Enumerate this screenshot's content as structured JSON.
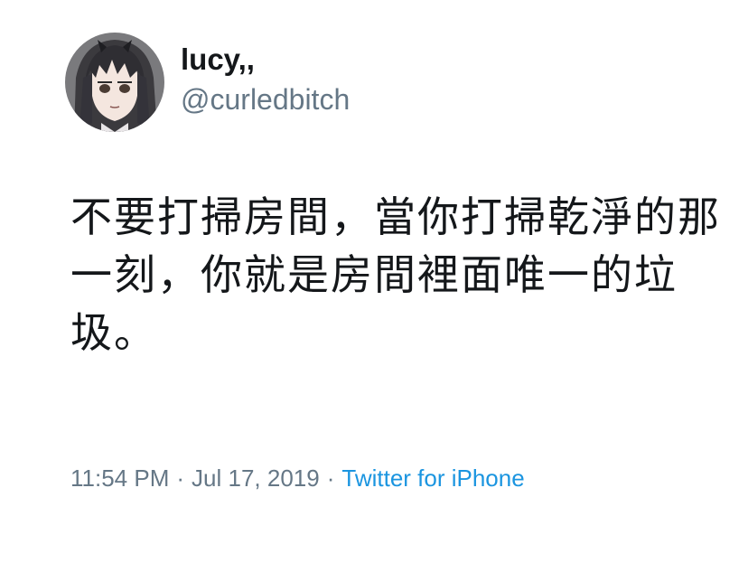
{
  "tweet": {
    "author": {
      "display_name": "lucy,,",
      "handle": "@curledbitch",
      "avatar_icon": "anime-character-avatar"
    },
    "text": "不要打掃房間，當你打掃乾淨的那一刻，你就是房間裡面唯一的垃圾。",
    "meta": {
      "time": "11:54 PM",
      "separator": "·",
      "date": "Jul 17, 2019",
      "source": "Twitter for iPhone"
    }
  },
  "colors": {
    "text_primary": "#14171a",
    "text_secondary": "#657786",
    "link": "#1b95e0",
    "background": "#ffffff"
  }
}
